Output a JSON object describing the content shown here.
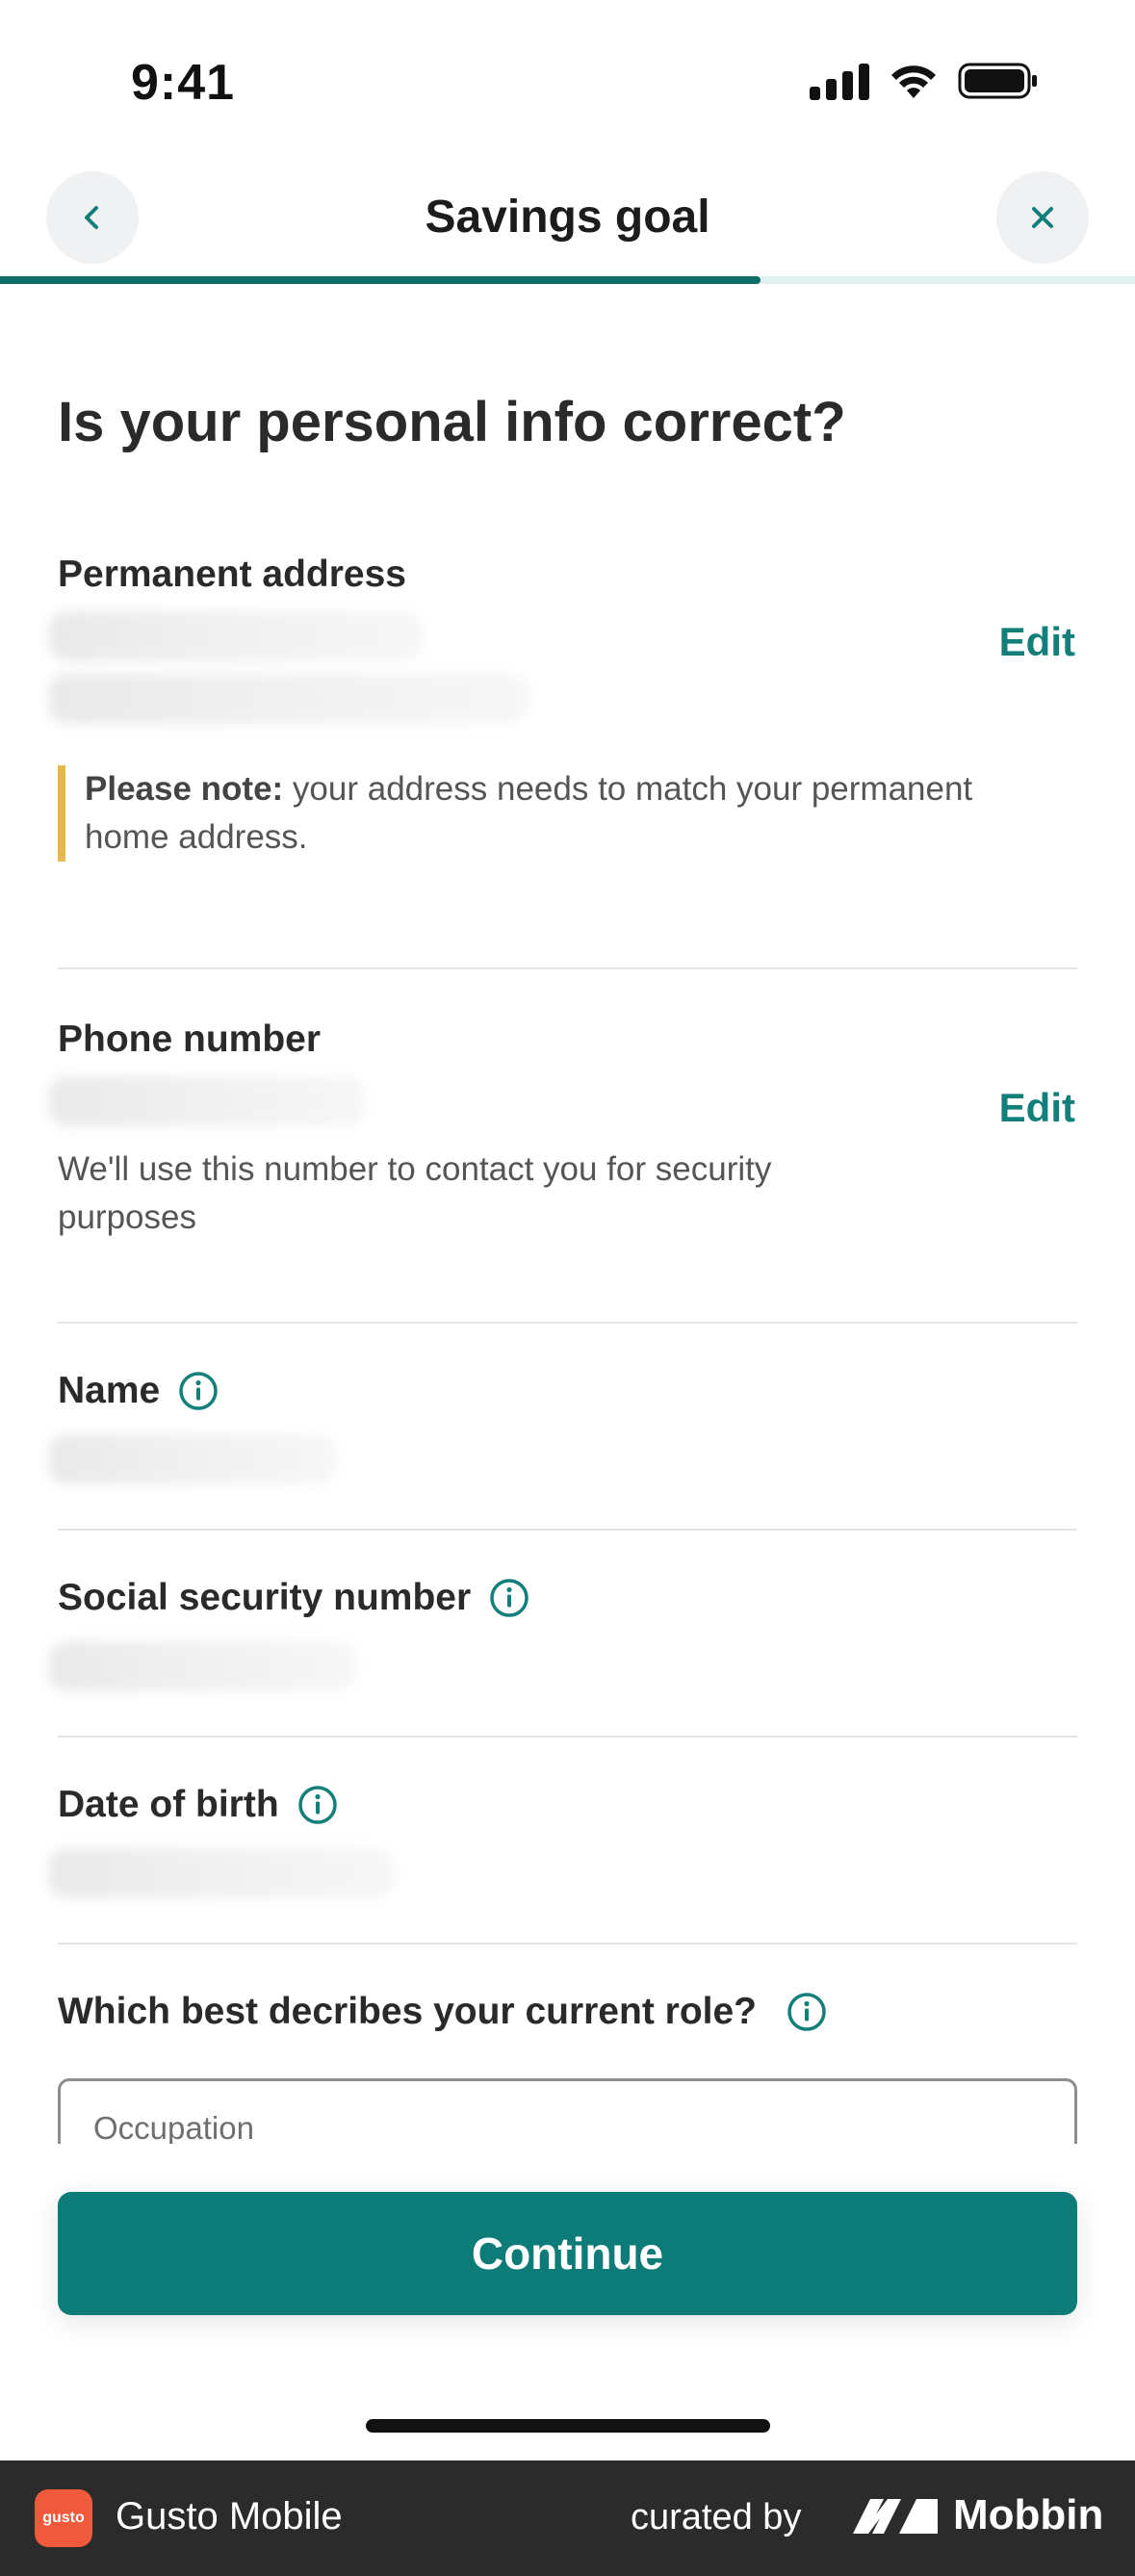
{
  "status_bar": {
    "time": "9:41"
  },
  "header": {
    "title": "Savings goal",
    "progress": 0.67
  },
  "page": {
    "title": "Is your personal info correct?"
  },
  "sections": {
    "address": {
      "label": "Permanent address",
      "edit_label": "Edit",
      "note_bold": "Please note:",
      "note_text": " your address needs to match your permanent home address."
    },
    "phone": {
      "label": "Phone number",
      "edit_label": "Edit",
      "helper": "We'll use this number to contact you for security purposes"
    },
    "name": {
      "label": "Name"
    },
    "ssn": {
      "label": "Social security number"
    },
    "dob": {
      "label": "Date of birth"
    },
    "role": {
      "label": "Which best decribes your current role?",
      "placeholder": "Occupation"
    }
  },
  "continue_label": "Continue",
  "footer": {
    "app_logo_text": "gusto",
    "app_name": "Gusto Mobile",
    "curated_by": "curated by",
    "brand": "Mobbin"
  },
  "colors": {
    "accent": "#0d7c78",
    "note_bar": "#e6b84d",
    "logo_bg": "#f05a3c"
  },
  "icons": [
    "chevron-left-icon",
    "close-icon",
    "info-icon",
    "signal-icon",
    "wifi-icon",
    "battery-icon"
  ]
}
